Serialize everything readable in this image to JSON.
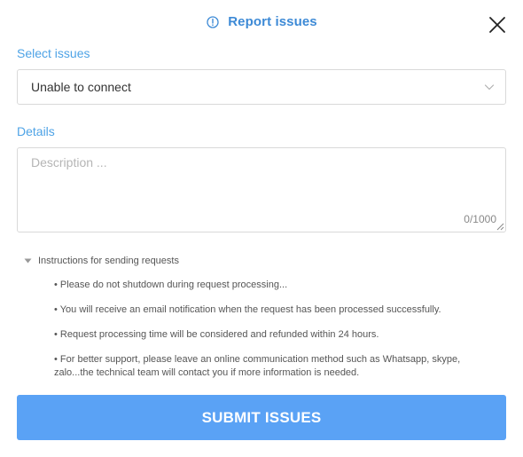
{
  "dialog": {
    "title": "Report issues",
    "icon": "info-circle-icon",
    "close_icon": "close-icon",
    "accent_color": "#3d8ad6"
  },
  "form": {
    "issues_label": "Select issues",
    "issues_selected": "Unable to connect",
    "details_label": "Details",
    "details_placeholder": "Description ...",
    "details_counter": "0/1000"
  },
  "instructions": {
    "heading": "Instructions for sending requests",
    "items": [
      "• Please do not shutdown during request processing...",
      "• You will receive an email notification when the request has been processed successfully.",
      "• Request processing time will be considered and refunded within 24 hours.",
      "• For better support, please leave an online communication method such as Whatsapp, skype, zalo...the technical team will contact you if more information is needed."
    ]
  },
  "submit": {
    "label": "SUBMIT ISSUES",
    "color": "#5aa2f5"
  }
}
